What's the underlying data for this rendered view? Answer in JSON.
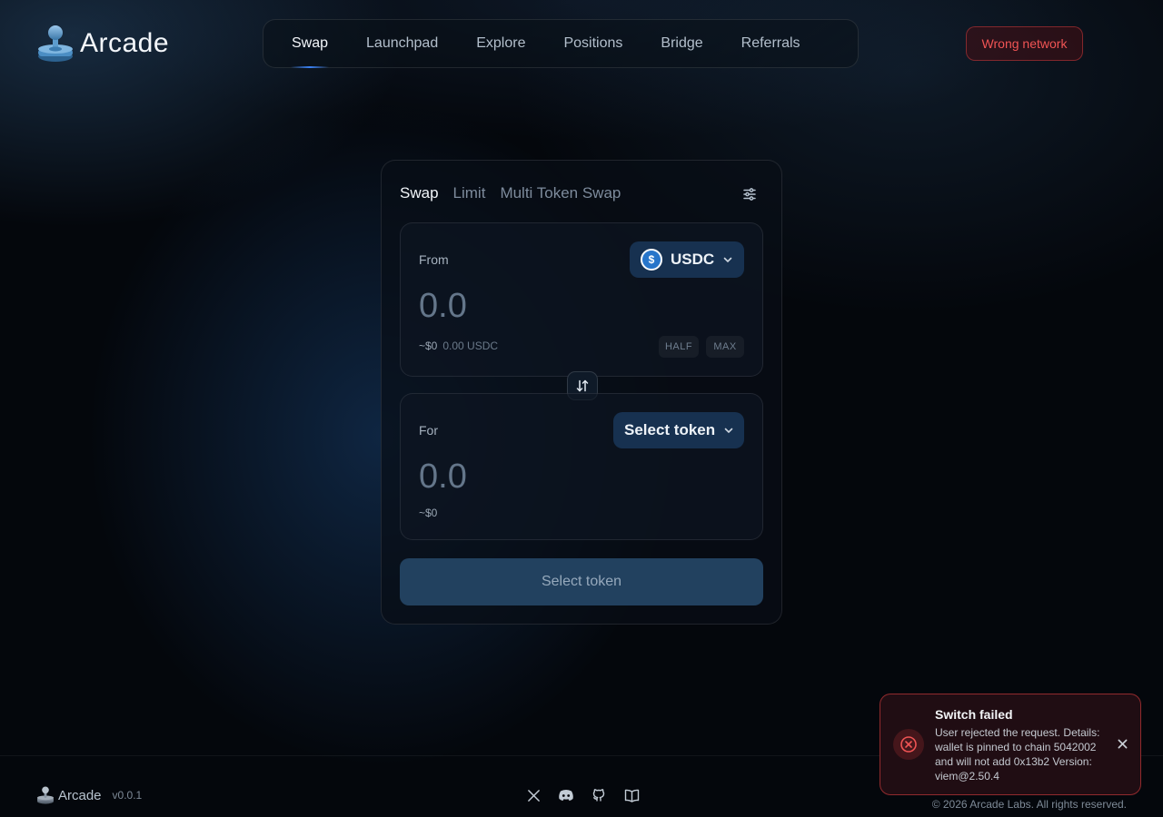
{
  "brand": {
    "name": "Arcade",
    "icon": "joystick-icon"
  },
  "nav": {
    "items": [
      {
        "label": "Swap",
        "active": true
      },
      {
        "label": "Launchpad",
        "active": false
      },
      {
        "label": "Explore",
        "active": false
      },
      {
        "label": "Positions",
        "active": false
      },
      {
        "label": "Bridge",
        "active": false
      },
      {
        "label": "Referrals",
        "active": false
      }
    ]
  },
  "network_button": {
    "label": "Wrong network",
    "color": "#f05454"
  },
  "swap": {
    "tabs": [
      {
        "label": "Swap",
        "active": true
      },
      {
        "label": "Limit",
        "active": false
      },
      {
        "label": "Multi Token Swap",
        "active": false
      }
    ],
    "settings_icon": "sliders-icon",
    "from": {
      "label": "From",
      "token": "USDC",
      "token_icon": "usdc-icon",
      "token_icon_glyph": "$",
      "amount": "0.0",
      "usd_value": "~$0",
      "balance": "0.00 USDC",
      "half_label": "HALF",
      "max_label": "MAX"
    },
    "switch_icon": "swap-arrows-icon",
    "to": {
      "label": "For",
      "token": "Select token",
      "amount": "0.0",
      "usd_value": "~$0"
    },
    "action_button": "Select token"
  },
  "footer": {
    "brand": "Arcade",
    "version": "v0.0.1",
    "socials": [
      "x-icon",
      "discord-icon",
      "github-icon",
      "docs-icon"
    ],
    "copyright": "© 2026 Arcade Labs. All rights reserved."
  },
  "toast": {
    "title": "Switch failed",
    "message": "User rejected the request. Details: wallet is pinned to chain 5042002 and will not add 0x13b2 Version: viem@2.50.4",
    "icon": "error-circle-icon",
    "close_icon": "close-icon"
  },
  "colors": {
    "background": "#04070c",
    "accent": "#3b82f6",
    "token_button": "#173150",
    "action_button": "#22415f",
    "error": "#ef4444"
  }
}
